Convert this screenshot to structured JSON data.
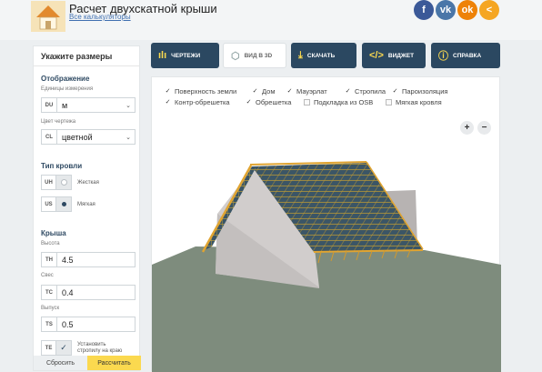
{
  "app": {
    "title": "Расчет двухскатной крыши",
    "all_calculators_link": "Все калькуляторы"
  },
  "social": [
    {
      "icon": "facebook-icon",
      "glyph": "f",
      "color": "#3b5998"
    },
    {
      "icon": "vk-icon",
      "glyph": "vk",
      "color": "#4a76a8"
    },
    {
      "icon": "ok-icon",
      "glyph": "ok",
      "color": "#ee8208"
    },
    {
      "icon": "share-icon",
      "glyph": "<",
      "color": "#f5a623"
    }
  ],
  "sidebar": {
    "title": "Укажите размеры",
    "display": {
      "heading": "Отображение",
      "units_label": "Единицы измерения",
      "units_code": "DU",
      "units_value": "м",
      "color_label": "Цвет чертежа",
      "color_code": "CL",
      "color_value": "цветной"
    },
    "roof_type": {
      "heading": "Тип кровли",
      "hard_code": "UH",
      "hard_label": "Жесткая",
      "soft_code": "US",
      "soft_label": "Мягкая",
      "selected": "soft"
    },
    "roof": {
      "heading": "Крыша",
      "height_label": "Высота",
      "height_code": "TH",
      "height_value": "4.5",
      "overhang_label": "Свес",
      "overhang_code": "TC",
      "overhang_value": "0.4",
      "outlet_label": "Выпуск",
      "outlet_code": "TS",
      "outlet_value": "0.5",
      "edge_code": "TE",
      "edge_label": "Установить стропилу на краю",
      "edge_checked": true
    },
    "reset_button": "Сбросить",
    "calculate_button": "Рассчитать"
  },
  "tabs": [
    {
      "name": "tab-drawings",
      "label": "ЧЕРТЕЖИ",
      "icon": "chart-icon",
      "glyph": "ılı",
      "active": false
    },
    {
      "name": "tab-3d-view",
      "label": "ВИД В 3D",
      "icon": "cube-icon",
      "glyph": "⬡",
      "active": true
    },
    {
      "name": "tab-download",
      "label": "СКАЧАТЬ",
      "icon": "download-icon",
      "glyph": "⤓",
      "active": false
    },
    {
      "name": "tab-widget",
      "label": "ВИДЖЕТ",
      "icon": "code-icon",
      "glyph": "</>",
      "active": false
    },
    {
      "name": "tab-help",
      "label": "СПРАВКА",
      "icon": "info-icon",
      "glyph": "ⓘ",
      "active": false
    }
  ],
  "layers": [
    {
      "name": "layer-ground",
      "label": "Поверхность земли",
      "checked": true
    },
    {
      "name": "layer-house",
      "label": "Дом",
      "checked": true
    },
    {
      "name": "layer-mauerlat",
      "label": "Мауэрлат",
      "checked": true
    },
    {
      "name": "layer-rafters",
      "label": "Стропила",
      "checked": true
    },
    {
      "name": "layer-vapor-barrier",
      "label": "Пароизоляция",
      "checked": true
    },
    {
      "name": "layer-counter-batten",
      "label": "Контр-обрешетка",
      "checked": true
    },
    {
      "name": "layer-batten",
      "label": "Обрешетка",
      "checked": true
    },
    {
      "name": "layer-osb-underlay",
      "label": "Подкладка из OSB",
      "checked": false
    },
    {
      "name": "layer-soft-roofing",
      "label": "Мягкая кровля",
      "checked": false
    }
  ],
  "zoom": {
    "in": "+",
    "out": "−"
  },
  "colors": {
    "navy": "#2b4861",
    "accent": "#fbd94f",
    "ground": "#7e8c7d",
    "wall": "#cfcccb",
    "roof_tile": "#35495a",
    "timber": "#e0a431"
  }
}
